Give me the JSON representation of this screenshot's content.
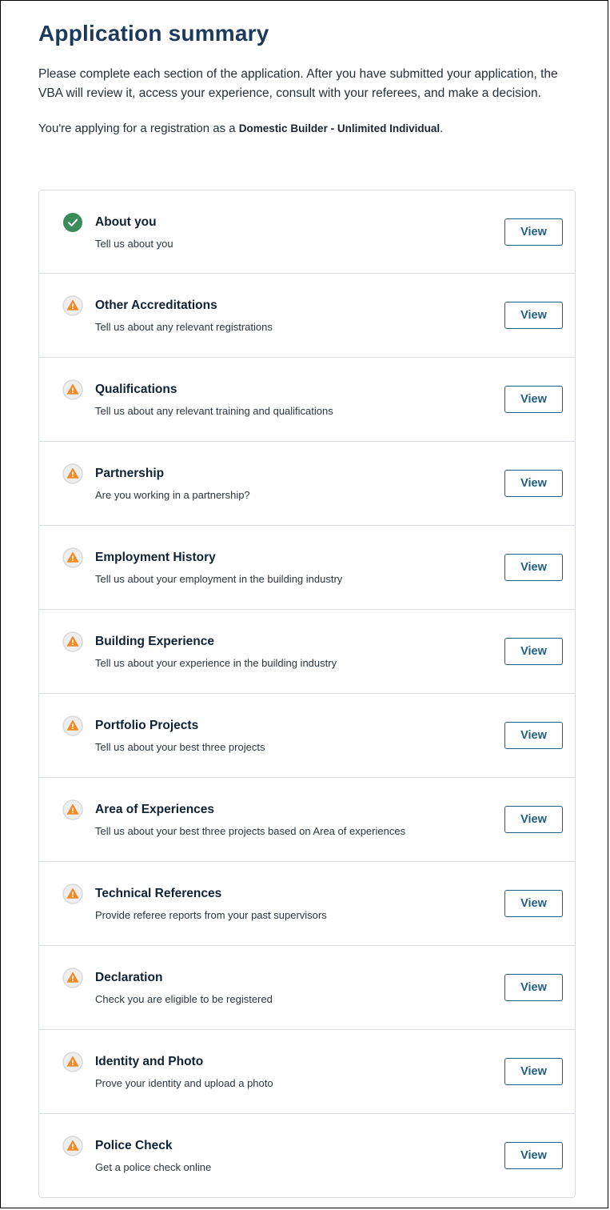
{
  "page": {
    "title": "Application summary",
    "intro": "Please complete each section of the application. After you have submitted your application, the VBA will review it, access your experience, consult with your referees, and make a decision.",
    "applying_prefix": "You're applying for a registration as a ",
    "applying_role": "Domestic Builder - Unlimited Individual",
    "applying_suffix": "."
  },
  "colors": {
    "complete": "#3b8a5a",
    "warning": "#f08a24",
    "warning_ring": "#d9d9d9",
    "button": "#1f5f84",
    "title": "#1b3a5c"
  },
  "sections": [
    {
      "title": "About you",
      "description": "Tell us about you",
      "status": "complete",
      "icon": "check-circle-icon",
      "button_label": "View"
    },
    {
      "title": "Other Accreditations",
      "description": "Tell us about any relevant registrations",
      "status": "warning",
      "icon": "warning-icon",
      "button_label": "View"
    },
    {
      "title": "Qualifications",
      "description": "Tell us about any relevant training and qualifications",
      "status": "warning",
      "icon": "warning-icon",
      "button_label": "View"
    },
    {
      "title": "Partnership",
      "description": "Are you working in a partnership?",
      "status": "warning",
      "icon": "warning-icon",
      "button_label": "View"
    },
    {
      "title": "Employment History",
      "description": "Tell us about your employment in the building industry",
      "status": "warning",
      "icon": "warning-icon",
      "button_label": "View"
    },
    {
      "title": "Building Experience",
      "description": "Tell us about your experience in the building industry",
      "status": "warning",
      "icon": "warning-icon",
      "button_label": "View"
    },
    {
      "title": "Portfolio Projects",
      "description": "Tell us about your best three projects",
      "status": "warning",
      "icon": "warning-icon",
      "button_label": "View"
    },
    {
      "title": "Area of Experiences",
      "description": "Tell us about your best three projects based on Area of experiences",
      "status": "warning",
      "icon": "warning-icon",
      "button_label": "View"
    },
    {
      "title": "Technical References",
      "description": "Provide referee reports from your past supervisors",
      "status": "warning",
      "icon": "warning-icon",
      "button_label": "View"
    },
    {
      "title": "Declaration",
      "description": "Check you are eligible to be registered",
      "status": "warning",
      "icon": "warning-icon",
      "button_label": "View"
    },
    {
      "title": "Identity and Photo",
      "description": "Prove your identity and upload a photo",
      "status": "warning",
      "icon": "warning-icon",
      "button_label": "View"
    },
    {
      "title": "Police Check",
      "description": "Get a police check online",
      "status": "warning",
      "icon": "warning-icon",
      "button_label": "View"
    }
  ]
}
